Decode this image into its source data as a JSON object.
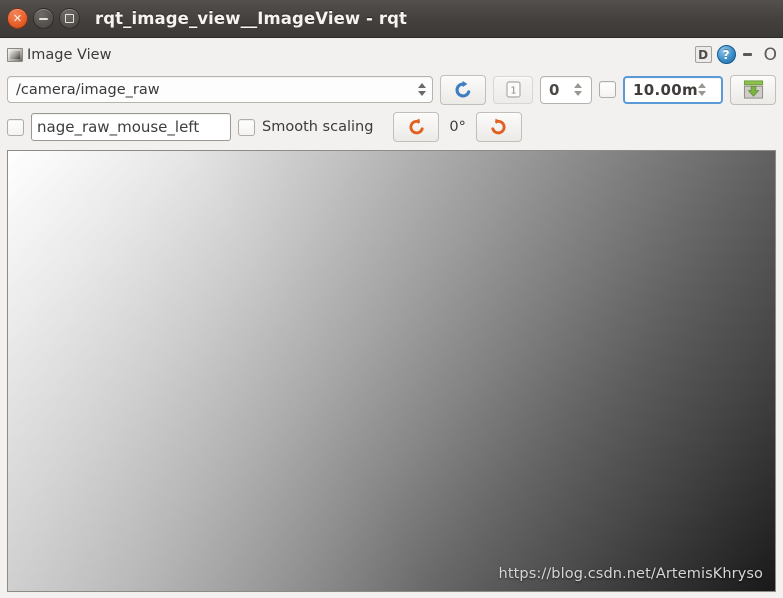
{
  "window": {
    "title": "rqt_image_view__ImageView - rqt",
    "controls": {
      "close": "×",
      "minimize": "−",
      "maximize": "□"
    }
  },
  "dock": {
    "title": "Image View",
    "icon": "image-view-icon",
    "buttons": {
      "float": "D",
      "help": "?",
      "minimize": "-",
      "close": "O"
    }
  },
  "toolbar": {
    "topic": {
      "value": "/camera/image_raw",
      "placeholder": "/camera/image_raw"
    },
    "refresh_icon": "refresh-topics-icon",
    "dynamic_range_label": "1",
    "index_spin": {
      "value": "0"
    },
    "dynamic_range_checkbox": false,
    "max_range": {
      "value": "10.00m"
    },
    "save_icon": "save-image-icon"
  },
  "options": {
    "publish_click_checkbox": false,
    "publish_topic_field": {
      "value": "nage_raw_mouse_left",
      "full_value": "/camera/image_raw_mouse_left"
    },
    "smooth_scaling_checkbox": false,
    "smooth_scaling_label": "Smooth scaling",
    "rotate_left_icon": "rotate-counterclockwise-icon",
    "rotation_label": "0°",
    "rotate_right_icon": "rotate-clockwise-icon"
  },
  "canvas": {
    "watermark": "https://blog.csdn.net/ArtemisKhryso",
    "gradient": {
      "top_left": "#ffffff",
      "top_right": "#474747",
      "bottom_left": "#b8b8b8",
      "bottom_right": "#1c1c1c",
      "center": "#888888"
    }
  },
  "colors": {
    "titlebar": "#44413e",
    "close_button": "#e8612a",
    "accent_blue": "#3d8fc9",
    "accent_orange": "#e0611f",
    "panel_bg": "#f2f1f0"
  }
}
